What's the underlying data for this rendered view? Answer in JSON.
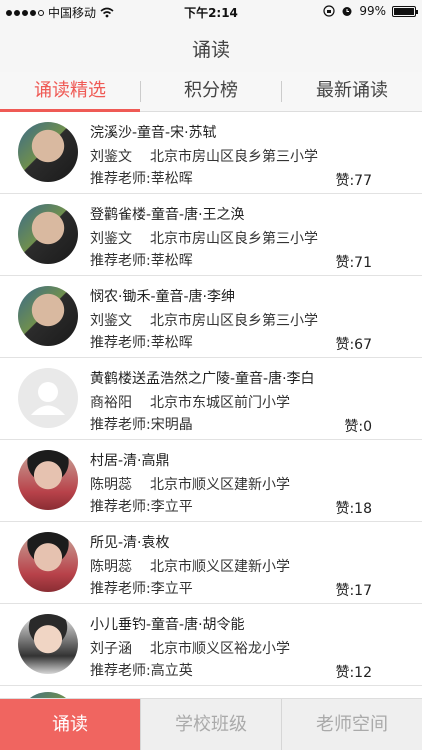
{
  "status_bar": {
    "carrier": "中国移动",
    "time": "下午2:14",
    "battery": "99%",
    "battery_level": 0.99,
    "signal_bars": 4
  },
  "nav": {
    "title": "诵读"
  },
  "tabs": [
    {
      "label": "诵读精选",
      "active": true
    },
    {
      "label": "积分榜",
      "active": false
    },
    {
      "label": "最新诵读",
      "active": false
    }
  ],
  "items": [
    {
      "title": "浣溪沙-童音-宋·苏轼",
      "student": "刘鉴文",
      "school": "北京市房山区良乡第三小学",
      "teacher": "推荐老师:莘松晖",
      "likes": "赞:77",
      "avatar": "photo-a"
    },
    {
      "title": "登鹳雀楼-童音-唐·王之涣",
      "student": "刘鉴文",
      "school": "北京市房山区良乡第三小学",
      "teacher": "推荐老师:莘松晖",
      "likes": "赞:71",
      "avatar": "photo-a"
    },
    {
      "title": "悯农·锄禾-童音-唐·李绅",
      "student": "刘鉴文",
      "school": "北京市房山区良乡第三小学",
      "teacher": "推荐老师:莘松晖",
      "likes": "赞:67",
      "avatar": "photo-a"
    },
    {
      "title": "黄鹤楼送孟浩然之广陵-童音-唐·李白",
      "student": "商裕阳",
      "school": "北京市东城区前门小学",
      "teacher": "推荐老师:宋明晶",
      "likes": "赞:0",
      "avatar": "placeholder"
    },
    {
      "title": "村居-清·高鼎",
      "student": "陈明蕊",
      "school": "北京市顺义区建新小学",
      "teacher": "推荐老师:李立平",
      "likes": "赞:18",
      "avatar": "photo-b"
    },
    {
      "title": "所见-清·袁枚",
      "student": "陈明蕊",
      "school": "北京市顺义区建新小学",
      "teacher": "推荐老师:李立平",
      "likes": "赞:17",
      "avatar": "photo-b"
    },
    {
      "title": "小儿垂钓-童音-唐·胡令能",
      "student": "刘子涵",
      "school": "北京市顺义区裕龙小学",
      "teacher": "推荐老师:高立英",
      "likes": "赞:12",
      "avatar": "photo-c"
    }
  ],
  "bottom_tabs": [
    {
      "label": "诵读",
      "active": true
    },
    {
      "label": "学校班级",
      "active": false
    },
    {
      "label": "老师空间",
      "active": false
    }
  ],
  "colors": {
    "accent": "#ef5a55",
    "bottom_active": "#f06560"
  }
}
